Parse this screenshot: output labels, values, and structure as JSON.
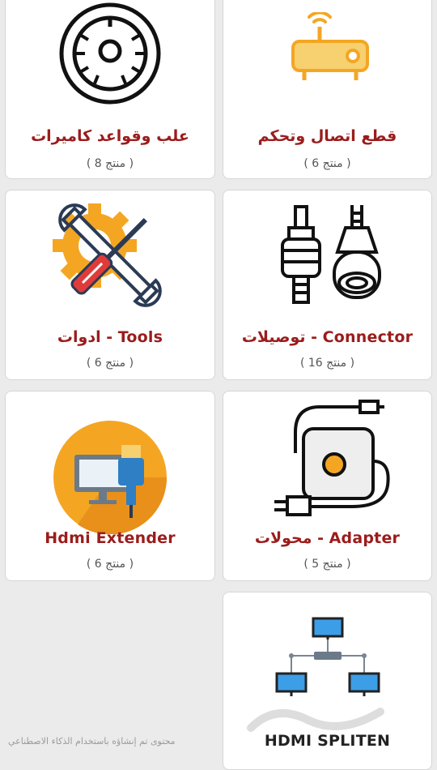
{
  "cards": [
    {
      "title": "علب وقواعد كاميرات",
      "count": "( 8 منتج )",
      "icon": "camera-dome-icon"
    },
    {
      "title": "قطع اتصال وتحكم",
      "count": "( 6 منتج )",
      "icon": "router-icon"
    },
    {
      "title": "ادوات - Tools",
      "count": "( 6 منتج )",
      "icon": "tools-icon"
    },
    {
      "title": "توصيلات - Connector",
      "count": "( 16 منتج )",
      "icon": "connector-icon"
    },
    {
      "title": "Hdmi Extender",
      "count": "( 6 منتج )",
      "icon": "hdmi-extender-icon"
    },
    {
      "title": "محولات - Adapter",
      "count": "( 5 منتج )",
      "icon": "adapter-icon"
    },
    {
      "title": "HDMI SPLITEN",
      "count": "",
      "icon": "network-splitter-icon"
    }
  ],
  "footer": {
    "ai_note": "محتوى تم إنشاؤه باستخدام الذكاء الاصطناعي"
  },
  "colors": {
    "title": "#9b1c1c",
    "background": "#ebebeb",
    "accent_orange": "#f4a623",
    "accent_yellow": "#f7d070"
  }
}
